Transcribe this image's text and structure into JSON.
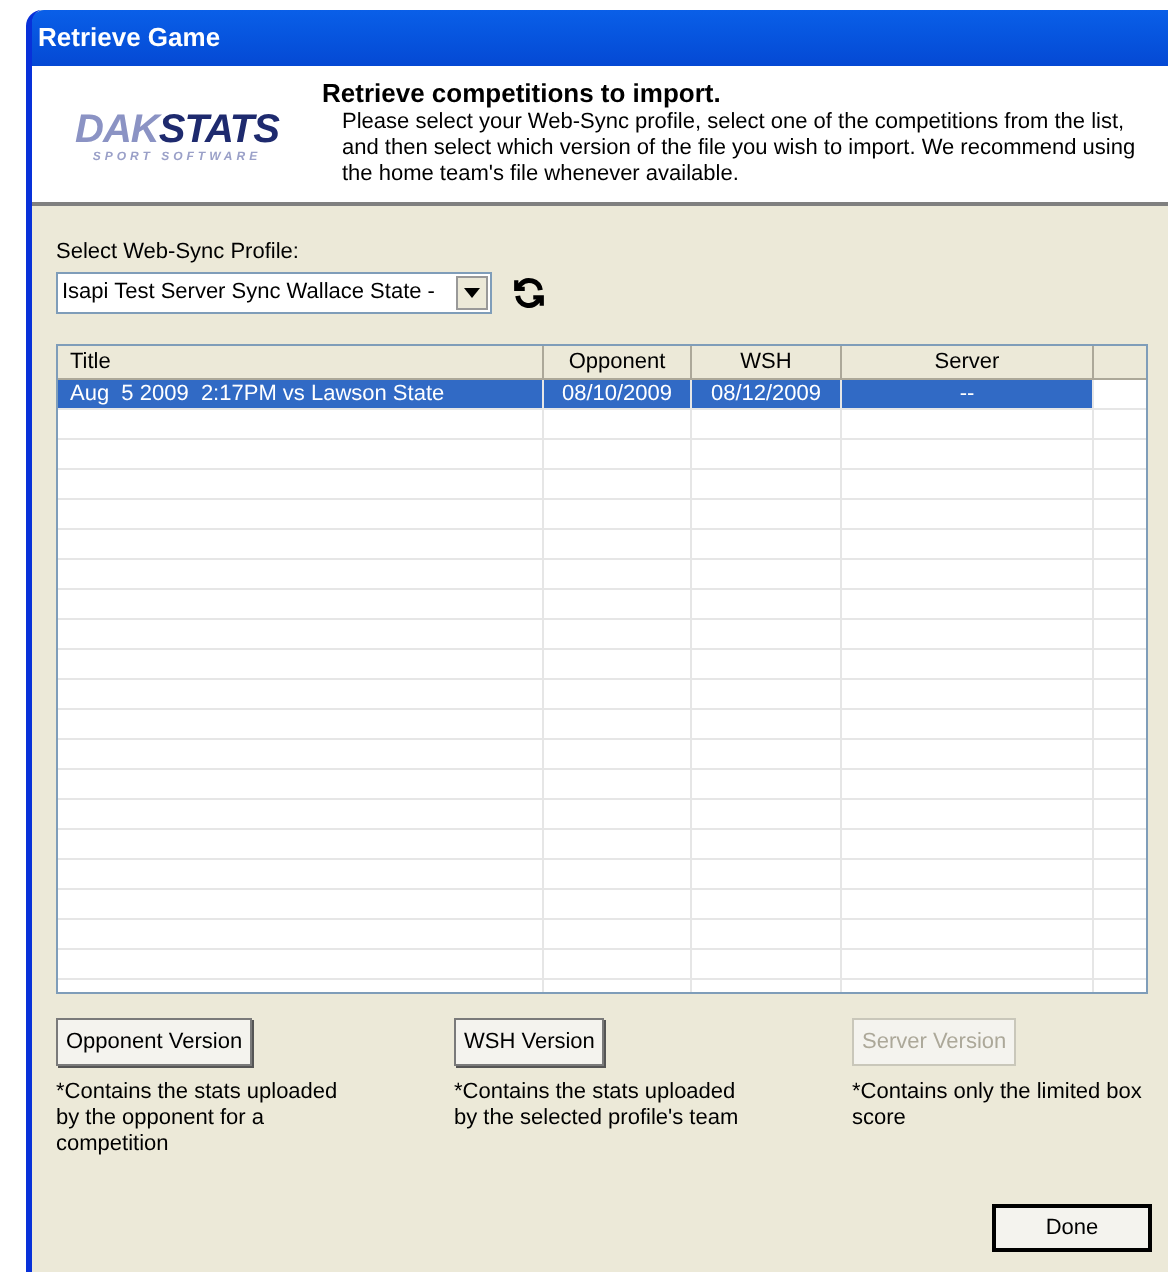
{
  "window": {
    "title": "Retrieve Game"
  },
  "logo": {
    "brand_left": "DAK",
    "brand_right": "STATS",
    "tagline": "SPORT SOFTWARE"
  },
  "header": {
    "title": "Retrieve competitions to import.",
    "description": "Please select your Web-Sync profile, select one of the competitions from the list, and then select which version of the file you wish to import. We recommend using the home team's file whenever available."
  },
  "profile": {
    "label": "Select Web-Sync Profile:",
    "value": "Isapi Test Server Sync Wallace State -"
  },
  "table": {
    "columns": [
      "Title",
      "Opponent",
      "WSH",
      "Server"
    ],
    "rows": [
      {
        "cells": [
          "Aug  5 2009  2:17PM vs Lawson State",
          "08/10/2009",
          "08/12/2009",
          "--"
        ],
        "selected": true
      }
    ]
  },
  "versions": [
    {
      "button": "Opponent Version",
      "disabled": false,
      "note": "*Contains the stats uploaded by the opponent for a competition"
    },
    {
      "button": "WSH Version",
      "disabled": false,
      "note": "*Contains the stats uploaded by the selected profile's team"
    },
    {
      "button": "Server Version",
      "disabled": true,
      "note": "*Contains only the limited box score"
    }
  ],
  "done_button": "Done"
}
